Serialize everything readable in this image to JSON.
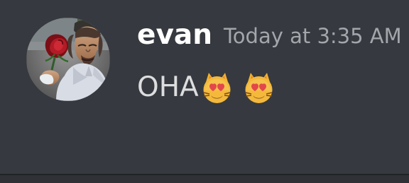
{
  "message": {
    "username": "evan",
    "timestamp": "Today at 3:35 AM",
    "text": "OHA",
    "emojis": [
      "smiling-cat-heart-eyes-emoji",
      "smiling-cat-heart-eyes-emoji"
    ]
  },
  "theme": {
    "background": "#36393f",
    "username_color": "#ffffff",
    "timestamp_color": "#a3a6aa",
    "text_color": "#dcddde",
    "divider_color": "#202225"
  },
  "icons": {
    "avatar": "user-avatar"
  }
}
